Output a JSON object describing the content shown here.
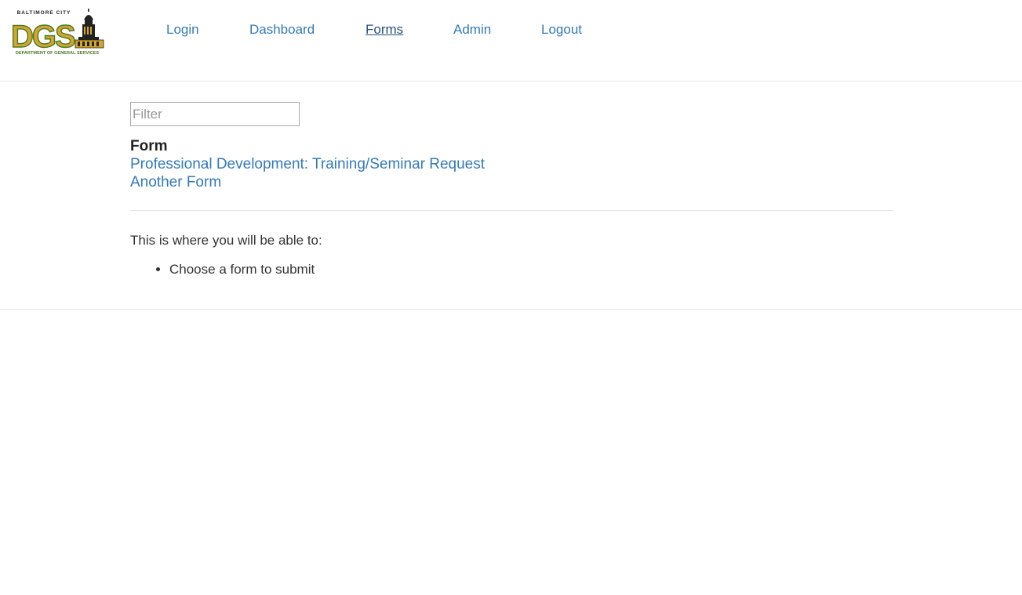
{
  "header": {
    "logo": {
      "top_text": "BALTIMORE CITY",
      "main_text": "DGS",
      "bottom_text": "DEPARTMENT OF GENERAL SERVICES"
    },
    "nav": [
      {
        "label": "Login",
        "active": false
      },
      {
        "label": "Dashboard",
        "active": false
      },
      {
        "label": "Forms",
        "active": true
      },
      {
        "label": "Admin",
        "active": false
      },
      {
        "label": "Logout",
        "active": false
      }
    ]
  },
  "main": {
    "filter": {
      "placeholder": "Filter",
      "value": ""
    },
    "form_heading": "Form",
    "forms": [
      {
        "label": "Professional Development: Training/Seminar Request"
      },
      {
        "label": "Another Form"
      }
    ],
    "intro": "This is where you will be able to:",
    "bullets": [
      "Choose a form to submit"
    ]
  },
  "colors": {
    "link": "#337ab7",
    "active_link": "#23527c",
    "logo_gold": "#c9a227",
    "logo_green": "#4a7a2a"
  }
}
